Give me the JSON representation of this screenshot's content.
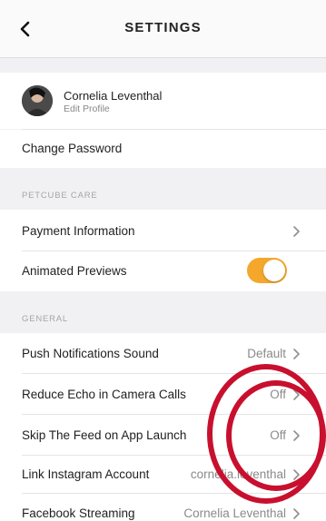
{
  "header": {
    "title": "SETTINGS",
    "back_icon": "chevron-left-icon"
  },
  "profile": {
    "name": "Cornelia Leventhal",
    "subtitle": "Edit Profile"
  },
  "account": {
    "change_password": "Change Password"
  },
  "petcube_care": {
    "section_title": "PETCUBE CARE",
    "payment_information": "Payment Information",
    "animated_previews": "Animated Previews",
    "animated_previews_on": true
  },
  "general": {
    "section_title": "GENERAL",
    "items": [
      {
        "label": "Push Notifications Sound",
        "value": "Default"
      },
      {
        "label": "Reduce Echo in Camera Calls",
        "value": "Off"
      },
      {
        "label": "Skip The Feed on App Launch",
        "value": "Off"
      },
      {
        "label": "Link Instagram Account",
        "value": "cornelia.leventhal"
      },
      {
        "label": "Facebook Streaming",
        "value": "Cornelia Leventhal"
      }
    ]
  },
  "colors": {
    "accent_toggle": "#f5a72b",
    "annotation_circle": "#c8102e"
  }
}
